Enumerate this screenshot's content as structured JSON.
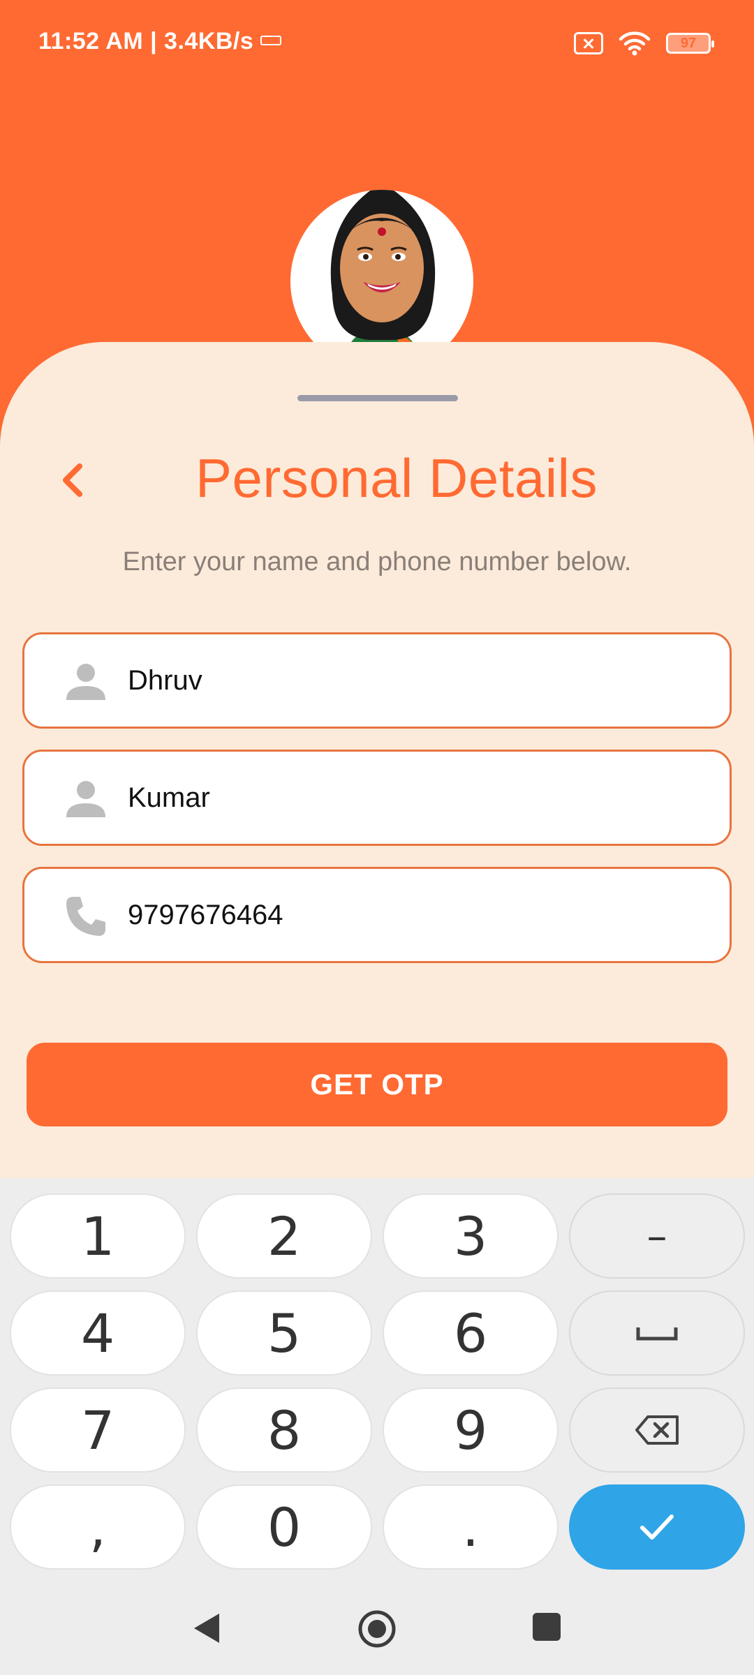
{
  "status_bar": {
    "time_speed": "11:52 AM | 3.4KB/s",
    "battery": "97"
  },
  "sheet": {
    "title": "Personal Details",
    "subtitle": "Enter your name and phone number below."
  },
  "form": {
    "first_name": "Dhruv",
    "last_name": "Kumar",
    "phone": "9797676464"
  },
  "get_otp_label": "GET OTP",
  "keyboard": {
    "keys": [
      "1",
      "2",
      "3",
      "–",
      "4",
      "5",
      "6",
      "7",
      "8",
      "9",
      ",",
      "0",
      "."
    ]
  },
  "colors": {
    "brand": "#FF6A33",
    "sheet": "#FCEBDA",
    "enter": "#2FA4E7"
  },
  "icons": [
    "sim-error-icon",
    "wifi-icon",
    "battery-icon",
    "back-chevron-icon",
    "person-icon",
    "phone-icon",
    "space-icon",
    "backspace-icon",
    "check-icon",
    "nav-back-icon",
    "nav-home-icon",
    "nav-recents-icon"
  ]
}
